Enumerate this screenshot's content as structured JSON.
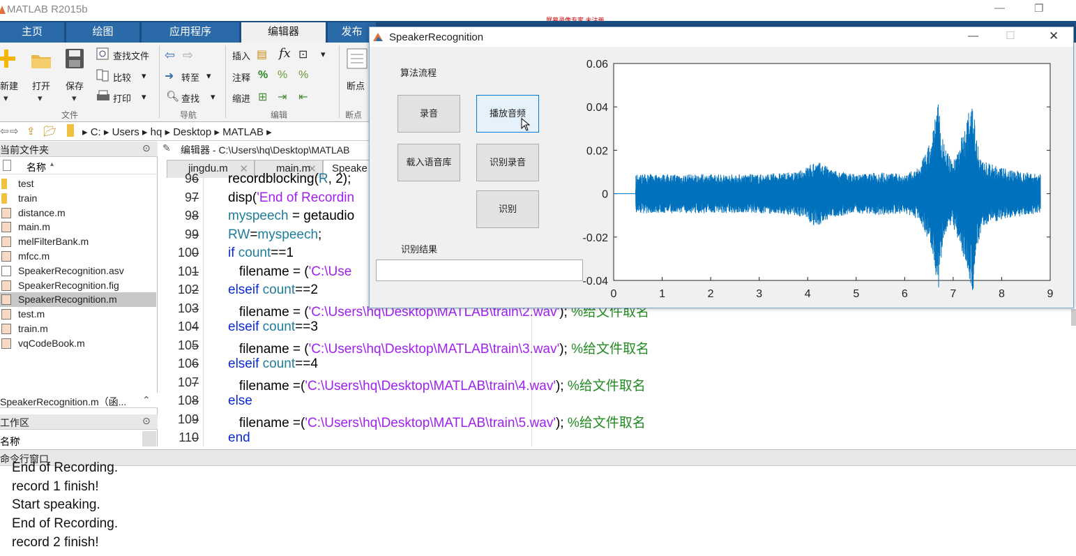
{
  "app": {
    "title": "MATLAB R2015b",
    "banner": "屏幕录像专家 未注册"
  },
  "tabs": [
    {
      "label": "主页"
    },
    {
      "label": "绘图"
    },
    {
      "label": "应用程序"
    },
    {
      "label": "编辑器"
    },
    {
      "label": "发布"
    }
  ],
  "ribbon": {
    "new": "新建",
    "open": "打开",
    "save": "保存",
    "find_files": "查找文件",
    "compare": "比较",
    "print": "打印",
    "goto": "转至",
    "find": "查找",
    "insert": "插入",
    "comment": "注释",
    "indent": "缩进",
    "breakpoints": "断点",
    "sections": {
      "file": "文件",
      "nav": "导航",
      "edit": "编辑",
      "breakpoints": "断点"
    }
  },
  "address": {
    "crumbs": [
      "C:",
      "Users",
      "hq",
      "Desktop",
      "MATLAB"
    ]
  },
  "filepanel": {
    "header": "当前文件夹",
    "col_name": "名称",
    "files": [
      {
        "name": "test",
        "type": "folder"
      },
      {
        "name": "train",
        "type": "folder"
      },
      {
        "name": "distance.m",
        "type": "m"
      },
      {
        "name": "main.m",
        "type": "m"
      },
      {
        "name": "melFilterBank.m",
        "type": "m"
      },
      {
        "name": "mfcc.m",
        "type": "m"
      },
      {
        "name": "SpeakerRecognition.asv",
        "type": "asv"
      },
      {
        "name": "SpeakerRecognition.fig",
        "type": "fig"
      },
      {
        "name": "SpeakerRecognition.m",
        "type": "m",
        "selected": true
      },
      {
        "name": "test.m",
        "type": "m"
      },
      {
        "name": "train.m",
        "type": "m"
      },
      {
        "name": "vqCodeBook.m",
        "type": "m"
      }
    ],
    "details": "SpeakerRecognition.m（函...",
    "workspace": "工作区",
    "ws_col": "名称"
  },
  "editor": {
    "title": "编辑器 - C:\\Users\\hq\\Desktop\\MATLAB",
    "tabs": [
      "jingdu.m",
      "main.m",
      "Speake"
    ],
    "lines": [
      {
        "n": "96",
        "html": "recordblocking(<span class='teal'>R</span>, 2);"
      },
      {
        "n": "97",
        "html": "disp(<span class='str'>'End of Recordin</span>"
      },
      {
        "n": "98",
        "html": "<span class='teal'>myspeech</span> = getaudio"
      },
      {
        "n": "99",
        "html": "<span class='teal'>RW</span>=<span class='teal'>myspeech</span>;"
      },
      {
        "n": "100",
        "html": "<span class='kw'>if</span> <span class='teal'>count</span>==1"
      },
      {
        "n": "101",
        "html": "   filename = (<span class='str'>'C:\\Use</span>"
      },
      {
        "n": "102",
        "html": "<span class='kw'>elseif</span> <span class='teal'>count</span>==2"
      },
      {
        "n": "103",
        "html": "   filename = (<span class='str'>'C:\\Users\\hq\\Desktop\\MATLAB\\train\\2.wav'</span>); <span class='cm'>%给文件取名</span>"
      },
      {
        "n": "104",
        "html": "<span class='kw'>elseif</span> <span class='teal'>count</span>==3"
      },
      {
        "n": "105",
        "html": "   filename = (<span class='str'>'C:\\Users\\hq\\Desktop\\MATLAB\\train\\3.wav'</span>); <span class='cm'>%给文件取名</span>"
      },
      {
        "n": "106",
        "html": "<span class='kw'>elseif</span> <span class='teal'>count</span>==4"
      },
      {
        "n": "107",
        "html": "   filename =(<span class='str'>'C:\\Users\\hq\\Desktop\\MATLAB\\train\\4.wav'</span>); <span class='cm'>%给文件取名</span>"
      },
      {
        "n": "108",
        "html": "<span class='kw'>else</span>"
      },
      {
        "n": "109",
        "html": "   filename =(<span class='str'>'C:\\Users\\hq\\Desktop\\MATLAB\\train\\5.wav'</span>); <span class='cm'>%给文件取名</span>"
      },
      {
        "n": "110",
        "html": "<span class='kw'>end</span>"
      }
    ]
  },
  "command_window": {
    "header": "命令行窗口",
    "lines": [
      "End of Recording.",
      "record 1 finish!",
      "Start speaking.",
      "End of Recording.",
      "record 2 finish!"
    ]
  },
  "figure": {
    "title": "SpeakerRecognition",
    "flow_label": "算法流程",
    "buttons": {
      "record": "录音",
      "play": "播放音频",
      "load_db": "载入语音库",
      "recognize_rec": "识别录音",
      "recognize": "识别"
    },
    "result_label": "识别结果",
    "result_value": ""
  },
  "chart_data": {
    "type": "line",
    "title": "",
    "xlabel": "",
    "ylabel": "",
    "xlim": [
      0,
      9
    ],
    "ylim": [
      -0.04,
      0.06
    ],
    "xticks": [
      "0",
      "1",
      "2",
      "3",
      "4",
      "5",
      "6",
      "7",
      "8",
      "9"
    ],
    "yticks": [
      "-0.04",
      "-0.02",
      "0",
      "0.02",
      "0.04",
      "0.06"
    ],
    "series": [
      {
        "color": "#0072bd",
        "x": [
          0.0,
          0.45,
          0.46,
          1.0,
          2.0,
          3.0,
          3.8,
          4.15,
          4.3,
          4.5,
          5.0,
          5.5,
          6.0,
          6.3,
          6.55,
          6.7,
          6.75,
          6.85,
          7.0,
          7.3,
          7.4,
          7.45,
          7.6,
          8.0,
          8.5,
          8.8
        ],
        "envelope": [
          0.0,
          0.0,
          0.009,
          0.009,
          0.009,
          0.009,
          0.01,
          0.015,
          0.014,
          0.011,
          0.009,
          0.01,
          0.009,
          0.012,
          0.025,
          0.045,
          0.03,
          0.02,
          0.015,
          0.035,
          0.05,
          0.03,
          0.015,
          0.012,
          0.01,
          0.009
        ]
      }
    ]
  },
  "colors": {
    "tabbar": "#1b4f84",
    "line": "#0072bd"
  }
}
